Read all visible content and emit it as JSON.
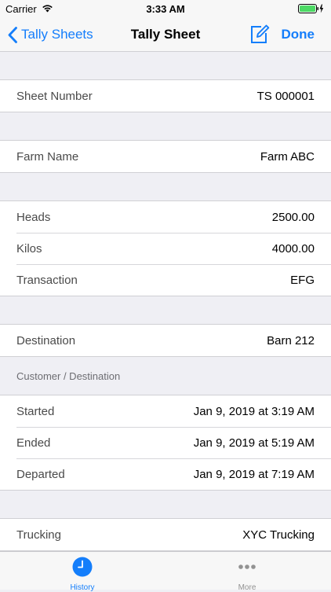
{
  "status_bar": {
    "carrier": "Carrier",
    "time": "3:33 AM"
  },
  "nav": {
    "back_label": "Tally Sheets",
    "title": "Tally Sheet",
    "done_label": "Done"
  },
  "sections": {
    "sheet": [
      {
        "label": "Sheet Number",
        "value": "TS 000001"
      }
    ],
    "farm": [
      {
        "label": "Farm Name",
        "value": "Farm ABC"
      }
    ],
    "stock": [
      {
        "label": "Heads",
        "value": "2500.00"
      },
      {
        "label": "Kilos",
        "value": "4000.00"
      },
      {
        "label": "Transaction",
        "value": "EFG"
      }
    ],
    "destination": [
      {
        "label": "Destination",
        "value": "Barn 212"
      }
    ],
    "destination_footer": "Customer / Destination",
    "times": [
      {
        "label": "Started",
        "value": "Jan 9, 2019 at 3:19 AM"
      },
      {
        "label": "Ended",
        "value": "Jan 9, 2019 at 5:19 AM"
      },
      {
        "label": "Departed",
        "value": "Jan 9, 2019 at 7:19 AM"
      }
    ],
    "trucking": [
      {
        "label": "Trucking",
        "value": "XYC Trucking"
      }
    ]
  },
  "tab_bar": {
    "tabs": [
      {
        "label": "History",
        "icon": "clock-icon",
        "selected": true
      },
      {
        "label": "More",
        "icon": "more-icon",
        "selected": false
      }
    ]
  },
  "colors": {
    "accent": "#147efb",
    "background": "#efeff4",
    "battery": "#4cd964"
  }
}
